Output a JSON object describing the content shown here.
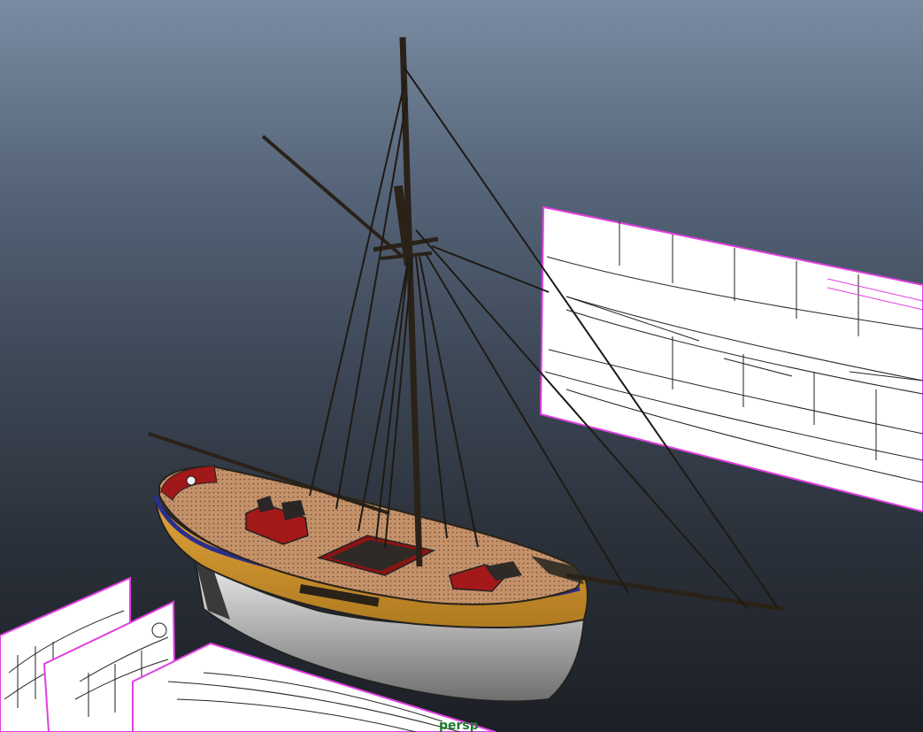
{
  "viewport": {
    "camera_name": "persp",
    "colors": {
      "background_top": "#7a8ca2",
      "background_bottom": "#1c1f25",
      "image_plane_border": "#e040e0",
      "hull_yellow": "#d79b2e",
      "hull_red": "#a01818",
      "rail_blue": "#2b2f8c",
      "deck": "#c4926a",
      "spar": "#2a2218",
      "camera_label": "#1f7a2e"
    }
  },
  "scene": {
    "objects": [
      {
        "name": "ship-model",
        "label": ""
      },
      {
        "name": "image-plane-side",
        "label": ""
      },
      {
        "name": "image-plane-bottom-1",
        "label": ""
      },
      {
        "name": "image-plane-bottom-2",
        "label": ""
      },
      {
        "name": "image-plane-bottom-3",
        "label": ""
      }
    ]
  }
}
